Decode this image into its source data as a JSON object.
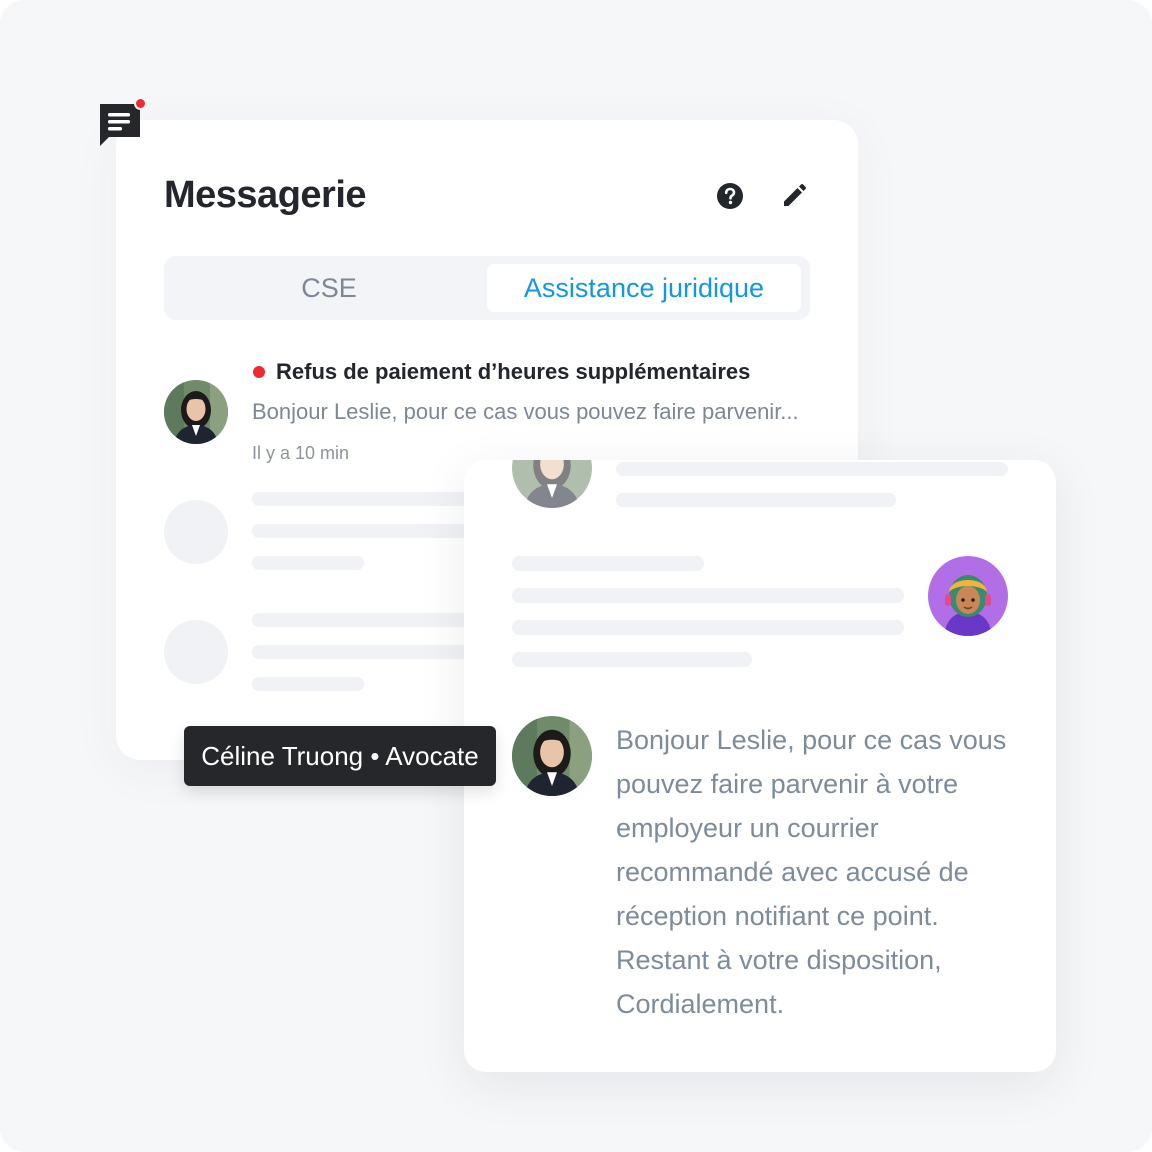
{
  "app": {
    "title": "Messagerie",
    "icons": {
      "app": "chat-bubble-icon",
      "help": "help-circle-icon",
      "edit": "pencil-icon"
    },
    "colors": {
      "accent": "#1297e4",
      "unread": "#ef2a2f",
      "title_text": "#23262d",
      "muted_text": "#7d8796",
      "skeleton": "#f1f2f5"
    }
  },
  "tabs": [
    {
      "label": "CSE",
      "active": false
    },
    {
      "label": "Assistance juridique",
      "active": true
    }
  ],
  "conversations": [
    {
      "title": "Refus de paiement d’heures supplémentaires",
      "preview": "Bonjour Leslie, pour ce cas vous pouvez faire parvenir...",
      "time": "Il y a 10 min",
      "unread": true
    }
  ],
  "tooltip": {
    "text": "Céline Truong • Avocate"
  },
  "chat": {
    "message_lines": [
      "Bonjour Leslie, pour ce cas vous",
      "pouvez faire parvenir à votre",
      "employeur un courrier",
      "recommandé avec accusé de",
      "réception notifiant ce point.",
      "Restant à votre disposition,",
      "Cordialement."
    ]
  }
}
